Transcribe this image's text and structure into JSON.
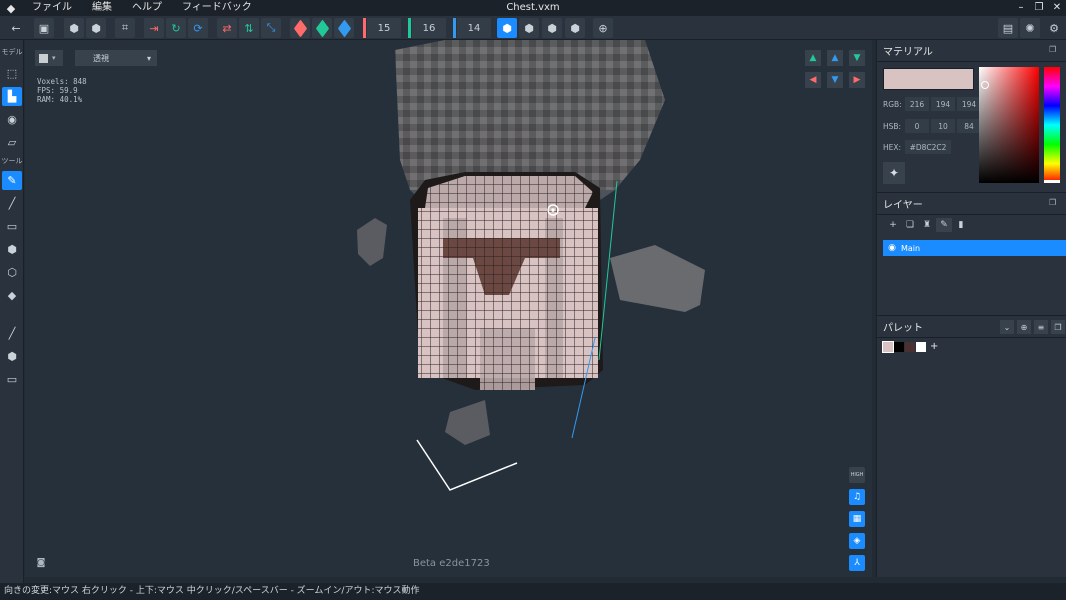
{
  "app": {
    "window_title": "Chest.vxm",
    "logo": "app-logo-icon",
    "menu": [
      "ファイル",
      "編集",
      "ヘルプ",
      "フィードバック"
    ]
  },
  "toolbar": {
    "numbers": [
      "15",
      "16",
      "14"
    ],
    "axis_colors": [
      "#ff6b6b",
      "#20c997",
      "#339af0"
    ]
  },
  "left_sidebar": {
    "section_model": "モデル",
    "section_tools": "ツール"
  },
  "viewport": {
    "view_mode": "透視",
    "stats": {
      "voxels": "Voxels: 848",
      "fps": "FPS: 59.9",
      "ram": "RAM: 40.1%"
    },
    "high_label": "HIGH",
    "version": "Beta e2de1723"
  },
  "material": {
    "title": "マテリアル",
    "preview_color": "#D8C2C2",
    "rgb_label": "RGB:",
    "rgb": [
      "216",
      "194",
      "194"
    ],
    "hsb_label": "HSB:",
    "hsb": [
      "0",
      "10",
      "84"
    ],
    "hex_label": "HEX:",
    "hex": "#D8C2C2"
  },
  "layers": {
    "title": "レイヤー",
    "items": [
      {
        "name": "Main",
        "visible": true
      }
    ]
  },
  "palette": {
    "title": "パレット",
    "colors": [
      "#D8C2C2",
      "#000000",
      "#4A3030",
      "#FFFFFF"
    ]
  },
  "statusbar": {
    "text": "向きの変更:マウス 右クリック - 上下:マウス 中クリック/スペースバー - ズームイン/アウト:マウス動作"
  }
}
